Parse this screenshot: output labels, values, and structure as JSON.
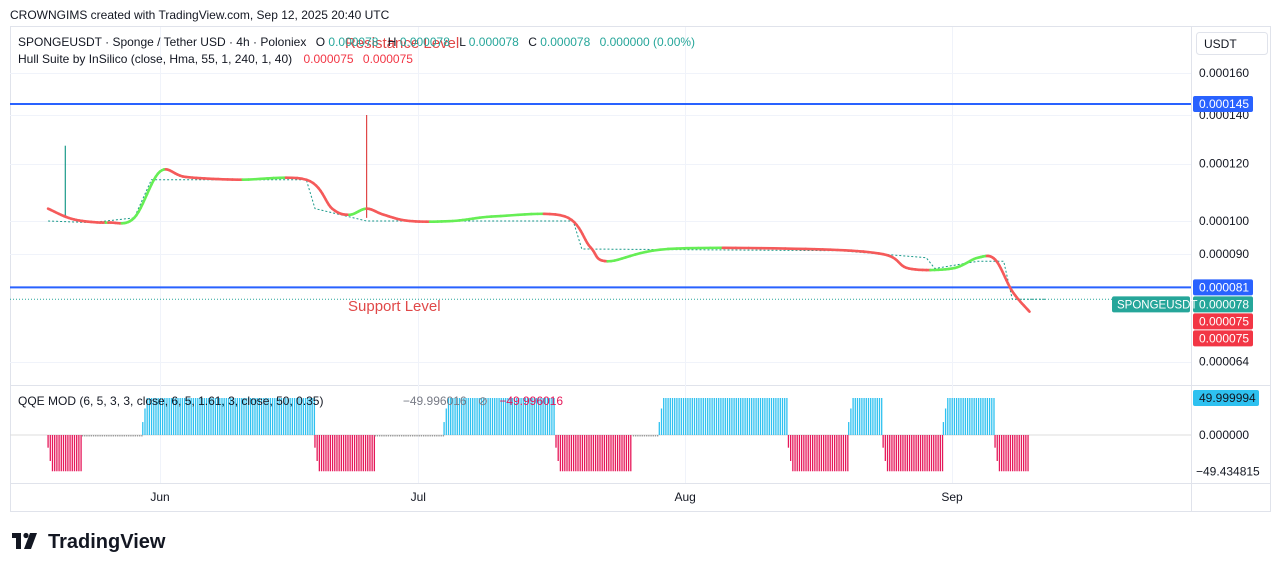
{
  "header": {
    "credit": "CROWNGIMS created with TradingView.com, Sep 12, 2025 20:40 UTC"
  },
  "legend": {
    "symbol_line": "SPONGEUSDT · Sponge / Tether USD · 4h · Poloniex",
    "o_label": "O",
    "o_value": "0.000078",
    "h_label": "H",
    "h_value": "0.000078",
    "l_label": "L",
    "l_value": "0.000078",
    "c_label": "C",
    "c_value": "0.000078",
    "change": "0.000000 (0.00%)",
    "hull_label": "Hull Suite by InSilico (close, Hma, 55, 1, 240, 1, 40)",
    "hull_v1": "0.000075",
    "hull_v2": "0.000075",
    "qqe_label": "QQE MOD (6, 5, 3, 3, close, 6, 5, 1.61, 3, close, 50, 0.35)",
    "qqe_v1": "−49.996016",
    "qqe_v2": "−49.996016"
  },
  "annotations": {
    "resistance": "Resistance Level",
    "support": "Support Level"
  },
  "price_axis": {
    "currency": "USDT",
    "ticks": [
      {
        "label": "0.000160",
        "value": 0.00016
      },
      {
        "label": "0.000140",
        "value": 0.00014
      },
      {
        "label": "0.000120",
        "value": 0.00012
      },
      {
        "label": "0.000100",
        "value": 0.0001
      },
      {
        "label": "0.000090",
        "value": 9e-05
      },
      {
        "label": "0.000064",
        "value": 6.4e-05
      }
    ],
    "badges": [
      {
        "label": "0.000145",
        "value": 0.000145,
        "color": "#2962ff"
      },
      {
        "label": "0.000081",
        "value": 8.1e-05,
        "color": "#2962ff"
      },
      {
        "label": "0.000078",
        "value": 7.8e-05,
        "color": "#26a69a",
        "tag": "SPONGEUSDT"
      },
      {
        "label": "0.000075",
        "value": 7.5e-05,
        "color": "#f23645"
      },
      {
        "label": "0.000075",
        "value": 7.5e-05,
        "color": "#f23645"
      }
    ]
  },
  "qqe_axis": {
    "ticks": [
      {
        "label": "49.999994",
        "value": 49.999994,
        "badge": true,
        "color": "#2ec1f0"
      },
      {
        "label": "0.000000",
        "value": 0
      },
      {
        "label": "−49.434815",
        "value": -49.434815
      }
    ]
  },
  "time_axis": {
    "labels": [
      {
        "label": "Jun",
        "date": "2025-06-01"
      },
      {
        "label": "Jul",
        "date": "2025-07-01"
      },
      {
        "label": "Aug",
        "date": "2025-08-01"
      },
      {
        "label": "Sep",
        "date": "2025-09-01"
      }
    ]
  },
  "branding": {
    "logo_text": "TradingView"
  },
  "colors": {
    "hull_up": "#66ee55",
    "hull_down": "#f55a5a",
    "step": "#1a9a8a",
    "line_blue": "#2962ff",
    "qqe_up": "#2ec1f0",
    "qqe_down": "#e6185a",
    "qqe_neutral": "#999999"
  },
  "chart_data": [
    {
      "type": "line",
      "title": "SPONGEUSDT · Sponge / Tether USD · 4h · Poloniex",
      "xlabel": "",
      "ylabel": "",
      "ylim": [
        6.2e-05,
        0.000166
      ],
      "scale": "log",
      "horizontal_lines": [
        {
          "label": "Resistance Level",
          "value": 0.000145
        },
        {
          "label": "Support Level",
          "value": 8.1e-05
        }
      ],
      "series": [
        {
          "name": "Hull Suite by InSilico (close, Hma, 55, 1, 240, 1, 40)",
          "points": [
            [
              "2025-05-19",
              0.000104
            ],
            [
              "2025-05-22",
              0.0001005
            ],
            [
              "2025-05-26",
              9.95e-05
            ],
            [
              "2025-05-29",
              0.000101
            ],
            [
              "2025-06-01",
              0.000117
            ],
            [
              "2025-06-04",
              0.000115
            ],
            [
              "2025-06-10",
              0.000114
            ],
            [
              "2025-06-18",
              0.000114
            ],
            [
              "2025-06-21",
              0.000104
            ],
            [
              "2025-06-23",
              0.000102
            ],
            [
              "2025-06-25",
              0.000104
            ],
            [
              "2025-06-27",
              0.000102
            ],
            [
              "2025-06-30",
              0.0001
            ],
            [
              "2025-07-05",
              0.0001
            ],
            [
              "2025-07-10",
              0.0001015
            ],
            [
              "2025-07-18",
              0.0001015
            ],
            [
              "2025-07-21",
              9.2e-05
            ],
            [
              "2025-07-23",
              8.8e-05
            ],
            [
              "2025-07-30",
              9.15e-05
            ],
            [
              "2025-08-15",
              9.15e-05
            ],
            [
              "2025-08-24",
              9e-05
            ],
            [
              "2025-08-27",
              8.6e-05
            ],
            [
              "2025-09-01",
              8.6e-05
            ],
            [
              "2025-09-04",
              8.9e-05
            ],
            [
              "2025-09-06",
              8.85e-05
            ],
            [
              "2025-09-08",
              8e-05
            ],
            [
              "2025-09-10",
              7.5e-05
            ]
          ]
        },
        {
          "name": "SPONGEUSDT",
          "points": [
            [
              "2025-05-19",
              0.0001
            ],
            [
              "2025-05-24",
              9.95e-05
            ],
            [
              "2025-05-29",
              0.000101
            ],
            [
              "2025-05-31",
              0.000114
            ],
            [
              "2025-06-18",
              0.000114
            ],
            [
              "2025-06-19",
              0.000104
            ],
            [
              "2025-06-25",
              0.0001
            ],
            [
              "2025-07-19",
              0.0001
            ],
            [
              "2025-07-20",
              9.15e-05
            ],
            [
              "2025-08-19",
              9.1e-05
            ],
            [
              "2025-08-29",
              8.9e-05
            ],
            [
              "2025-08-30",
              8.6e-05
            ],
            [
              "2025-09-04",
              8.8e-05
            ],
            [
              "2025-09-07",
              8.8e-05
            ],
            [
              "2025-09-08",
              7.8e-05
            ],
            [
              "2025-09-12",
              7.8e-05
            ]
          ],
          "spikes": [
            [
              "2025-05-21",
              0.000127
            ],
            [
              "2025-06-25",
              0.00014
            ]
          ]
        }
      ]
    },
    {
      "type": "bar",
      "title": "QQE MOD (6, 5, 3, 3, close, 6, 5, 1.61, 3, close, 50, 0.35)",
      "xlabel": "",
      "ylabel": "",
      "ylim": [
        -52,
        55
      ],
      "segments": [
        {
          "start": "2025-05-19",
          "end": "2025-05-23",
          "value": -49,
          "state": "down"
        },
        {
          "start": "2025-05-23",
          "end": "2025-05-30",
          "value": -2,
          "state": "neutral"
        },
        {
          "start": "2025-05-30",
          "end": "2025-06-19",
          "value": 50,
          "state": "up"
        },
        {
          "start": "2025-06-19",
          "end": "2025-06-26",
          "value": -49,
          "state": "down"
        },
        {
          "start": "2025-06-26",
          "end": "2025-07-04",
          "value": -2,
          "state": "neutral"
        },
        {
          "start": "2025-07-04",
          "end": "2025-07-17",
          "value": 50,
          "state": "up"
        },
        {
          "start": "2025-07-17",
          "end": "2025-07-26",
          "value": -49,
          "state": "down"
        },
        {
          "start": "2025-07-26",
          "end": "2025-07-29",
          "value": -2,
          "state": "neutral"
        },
        {
          "start": "2025-07-29",
          "end": "2025-08-13",
          "value": 50,
          "state": "up"
        },
        {
          "start": "2025-08-13",
          "end": "2025-08-20",
          "value": -49,
          "state": "down"
        },
        {
          "start": "2025-08-20",
          "end": "2025-08-24",
          "value": 50,
          "state": "up"
        },
        {
          "start": "2025-08-24",
          "end": "2025-08-31",
          "value": -49,
          "state": "down"
        },
        {
          "start": "2025-08-31",
          "end": "2025-09-06",
          "value": 50,
          "state": "up"
        },
        {
          "start": "2025-09-06",
          "end": "2025-09-10",
          "value": -49,
          "state": "down"
        }
      ]
    }
  ]
}
